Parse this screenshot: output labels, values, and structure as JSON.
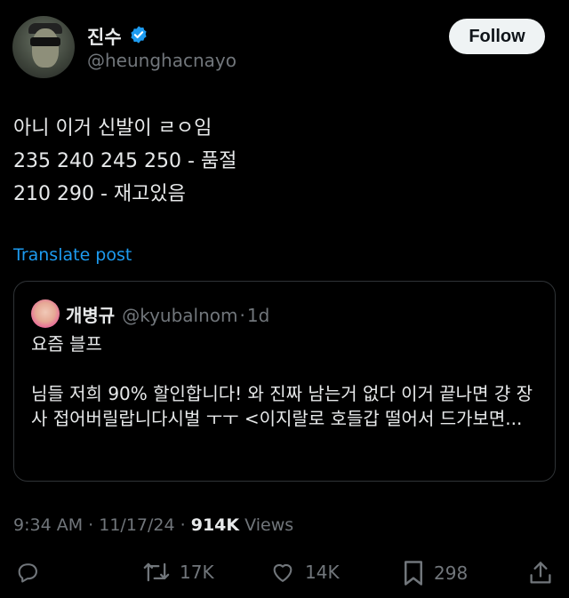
{
  "author": {
    "display_name": "진수",
    "handle": "@heunghacnayo",
    "verified_badge": "verified-check-icon"
  },
  "follow_label": "Follow",
  "tweet": {
    "lines": [
      "아니 이거 신발이 ㄹㅇ임",
      "235 240 245 250 - 품절",
      "210 290 - 재고있음"
    ]
  },
  "translate_label": "Translate post",
  "quote": {
    "display_name": "개병규",
    "handle": "@kyubalnom",
    "separator": "·",
    "time": "1d",
    "paragraphs": [
      "요즘 블프",
      "님들 저희 90% 할인합니다! 와 진짜 남는거 없다 이거 끝나면 걍 장사 접어버릴랍니다시벌 ㅜㅜ <이지랄로 호들갑 떨어서 드가보면..."
    ]
  },
  "meta": {
    "time": "9:34 AM",
    "date": "11/17/24",
    "views_count": "914K",
    "views_label": "Views"
  },
  "actions": {
    "reposts": "17K",
    "likes": "14K",
    "bookmarks": "298"
  },
  "colors": {
    "background": "#000000",
    "text": "#e7e9ea",
    "muted": "#71767b",
    "accent": "#1d9bf0",
    "border": "#2f3336"
  }
}
